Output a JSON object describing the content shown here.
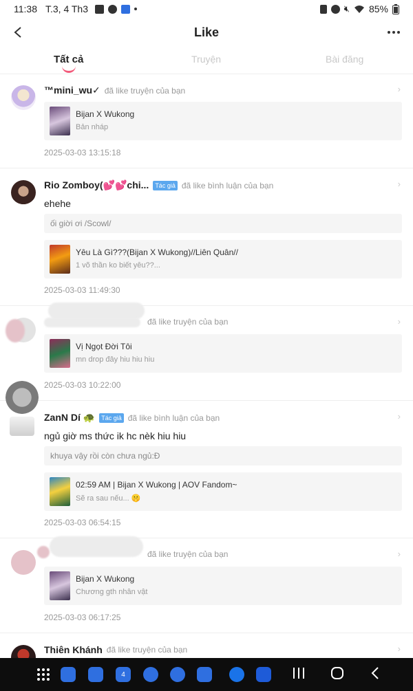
{
  "status_bar": {
    "time": "11:38",
    "date": "T.3, 4 Th3",
    "battery": "85%"
  },
  "header": {
    "title": "Like"
  },
  "tabs": [
    {
      "label": "Tất cả",
      "active": true
    },
    {
      "label": "Truyện",
      "active": false
    },
    {
      "label": "Bài đăng",
      "active": false
    }
  ],
  "feed": [
    {
      "name": "™mini_wu✓",
      "badge": "",
      "action": "đã like truyện của bạn",
      "comment": "",
      "quote": "",
      "card_title": "Bijan X Wukong",
      "card_sub": "Bản nháp",
      "time": "2025-03-03 13:15:18"
    },
    {
      "name": "Rio Zomboy(💕💕chi...",
      "badge": "Tác giả",
      "action": "đã like bình luận của bạn",
      "comment": "ehehe",
      "quote": "ối giời ơi /Scowl/",
      "card_title": "Yêu Là Gì???(Bijan X Wukong)//Liên Quân//",
      "card_sub": "1 võ thần ko biết yêu??...",
      "time": "2025-03-03 11:49:30"
    },
    {
      "name": "",
      "badge": "",
      "action": "đã like truyện của bạn",
      "comment": "",
      "quote": "",
      "card_title": "Vị Ngọt Đời Tôi",
      "card_sub": "mn drop đây hiu hiu hiu",
      "time": "2025-03-03 10:22:00"
    },
    {
      "name": "ZanN Dí 🐢",
      "badge": "Tác giả",
      "action": "đã like bình luận của bạn",
      "comment": "ngủ giờ ms thức ik hc nèk hiu hiu",
      "quote": "khuya vậy rồi còn chưa ngủ:Đ",
      "card_title": "02:59 AM | Bijan X Wukong | AOV Fandom~",
      "card_sub": "Sẽ ra sau nếu... 🤫",
      "time": "2025-03-03 06:54:15"
    },
    {
      "name": "",
      "badge": "",
      "action": "đã like truyện của bạn",
      "comment": "",
      "quote": "",
      "card_title": "Bijan X Wukong",
      "card_sub": "Chương gth nhân vật",
      "time": "2025-03-03 06:17:25"
    },
    {
      "name": "Thiên Khánh",
      "badge": "",
      "action": "đã like truyện của bạn",
      "comment": "",
      "quote": "",
      "card_title": "",
      "card_sub": "",
      "time": ""
    }
  ],
  "icons": {
    "back": "chevron-left-icon",
    "more": "more-icon",
    "item_arrow": "chevron-right-icon"
  },
  "colors": {
    "tab_indicator": "#f25a7a",
    "badge_bg": "#5ba7ee",
    "card_bg": "#f5f5f5",
    "navbar_bg": "#0d0d0d"
  },
  "navbar": {
    "calendar_day": "4"
  }
}
